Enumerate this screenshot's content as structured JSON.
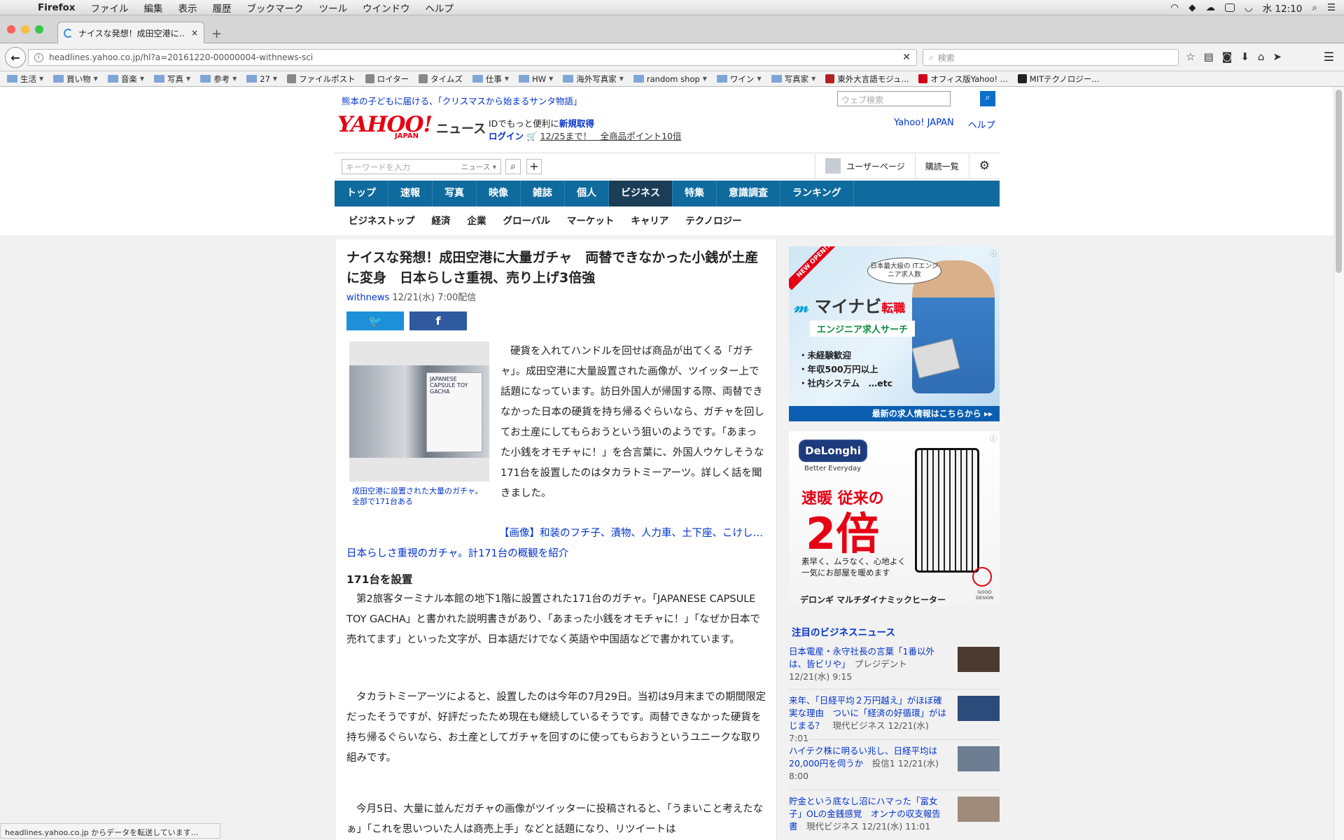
{
  "os_menu": {
    "app": "Firefox",
    "items": [
      "ファイル",
      "編集",
      "表示",
      "履歴",
      "ブックマーク",
      "ツール",
      "ウインドウ",
      "ヘルプ"
    ],
    "clock": "水 12:10"
  },
  "browser": {
    "tab_title": "ナイスな発想！成田空港に…",
    "url": "headlines.yahoo.co.jp/hl?a=20161220-00000004-withnews-sci",
    "search_placeholder": "検索",
    "bookmarks": [
      {
        "label": "生活",
        "type": "folder"
      },
      {
        "label": "買い物",
        "type": "folder"
      },
      {
        "label": "音楽",
        "type": "folder"
      },
      {
        "label": "写真",
        "type": "folder"
      },
      {
        "label": "参考",
        "type": "folder"
      },
      {
        "label": "27",
        "type": "folder"
      },
      {
        "label": "ファイルポスト",
        "type": "site"
      },
      {
        "label": "ロイター",
        "type": "site"
      },
      {
        "label": "タイムズ",
        "type": "site"
      },
      {
        "label": "仕事",
        "type": "folder"
      },
      {
        "label": "HW",
        "type": "folder"
      },
      {
        "label": "海外写真家",
        "type": "folder"
      },
      {
        "label": "random shop",
        "type": "folder"
      },
      {
        "label": "ワイン",
        "type": "folder"
      },
      {
        "label": "写真家",
        "type": "folder"
      },
      {
        "label": "東外大言語モジュ...",
        "type": "site"
      },
      {
        "label": "オフィス版Yahoo! ...",
        "type": "site"
      },
      {
        "label": "MITテクノロジー...",
        "type": "site"
      }
    ],
    "status": "headlines.yahoo.co.jp からデータを転送しています..."
  },
  "header": {
    "notice": "熊本の子どもに届ける、「クリスマスから始まるサンタ物語」",
    "web_search_placeholder": "ウェブ検索",
    "logo_text": "YAHOO!",
    "logo_sub": "JAPAN",
    "section": "ニュース",
    "id_line1_prefix": "IDでもっと便利に",
    "id_line1_link": "新規取得",
    "login": "ログイン",
    "promo": "12/25まで！　全商品ポイント10倍",
    "links": [
      "Yahoo! JAPAN",
      "ヘルプ"
    ],
    "keyword_placeholder": "キーワードを入力",
    "keyword_scope": "ニュース",
    "user_page": "ユーザーページ",
    "subscriptions": "購読一覧"
  },
  "nav": {
    "main": [
      "トップ",
      "速報",
      "写真",
      "映像",
      "雑誌",
      "個人",
      "ビジネス",
      "特集",
      "意識調査",
      "ランキング"
    ],
    "active": "ビジネス",
    "sub": [
      "ビジネストップ",
      "経済",
      "企業",
      "グローバル",
      "マーケット",
      "キャリア",
      "テクノロジー"
    ]
  },
  "article": {
    "title": "ナイスな発想！成田空港に大量ガチャ　両替できなかった小銭が土産に変身　日本らしさ重視、売り上げ3倍強",
    "source": "withnews",
    "date": "12/21(水) 7:00配信",
    "photo_caption": "成田空港に設置された大量のガチャ。全部で171台ある",
    "photo_card_text": "JAPANESE CAPSULE TOY GACHA",
    "lead": "硬貨を入れてハンドルを回せば商品が出てくる「ガチャ」。成田空港に大量設置された画像が、ツイッター上で話題になっています。訪日外国人が帰国する際、両替できなかった日本の硬貨を持ち帰るぐらいなら、ガチャを回してお土産にしてもらおうという狙いのようです。「あまった小銭をオモチャに！」を合言葉に、外国人ウケしそうな171台を設置したのはタカラトミーアーツ。詳しく話を聞きました。",
    "image_link": "【画像】和装のフチ子、漬物、人力車、土下座、こけし…　日本らしさ重視のガチャ。計171台の概観を紹介",
    "heading": "171台を設置",
    "paragraphs": [
      "第2旅客ターミナル本館の地下1階に設置された171台のガチャ。「JAPANESE CAPSULE TOY GACHA」と書かれた説明書きがあり、「あまった小銭をオモチャに！」「なぜか日本で売れてます」といった文字が、日本語だけでなく英語や中国語などで書かれています。",
      "タカラトミーアーツによると、設置したのは今年の7月29日。当初は9月末までの期間限定だったそうですが、好評だったため現在も継続しているそうです。両替できなかった硬貨を持ち帰るぐらいなら、お土産としてガチャを回すのに使ってもらおうというユニークな取り組みです。",
      "今月5日、大量に並んだガチャの画像がツイッターに投稿されると、「うまいこと考えたなぁ」「これを思いついた人は商売上手」などと話題になり、リツイートは"
    ]
  },
  "ads": {
    "mynavi": {
      "ribbon": "NEW OPEN!!",
      "bubble": "日本最大級の ITエンジニア求人数",
      "brand": "マイナビ",
      "brand_suffix": "転職",
      "sub": "エンジニア求人サーチ",
      "bullets": [
        "・未経験歓迎",
        "・年収500万円以上",
        "・社内システム　…etc"
      ],
      "cta": "最新の求人情報はこちらから ▸▸"
    },
    "delonghi": {
      "brand": "DeLonghi",
      "tagline": "Better Everyday",
      "headline": "速暖 従来の",
      "big": "2倍",
      "copy": "素早く、ムラなく、心地よく\n一気にお部屋を暖めます",
      "product": "デロンギ マルチダイナミックヒーター",
      "badge": "GOOD DESIGN"
    }
  },
  "biz_news": {
    "heading": "注目のビジネスニュース",
    "items": [
      {
        "title": "日本電産・永守社長の言葉「1番以外は、皆ビリや」",
        "meta": "プレジデント 12/21(水) 9:15",
        "thumb": "#4a3a30"
      },
      {
        "title": "来年、「日経平均２万円越え」がほぼ確実な理由　ついに「経済の好循環」がはじまる？",
        "meta": "現代ビジネス 12/21(水) 7:01",
        "thumb": "#2c4a7a"
      },
      {
        "title": "ハイテク株に明るい兆し、日経平均は20,000円を伺うか",
        "meta": "投信1 12/21(水) 8:00",
        "thumb": "#6d7e93"
      },
      {
        "title": "貯金という底なし沼にハマった「富女子」OLの金銭感覚　オンナの収支報告書",
        "meta": "現代ビジネス 12/21(水) 11:01",
        "thumb": "#a08a7a"
      }
    ]
  }
}
